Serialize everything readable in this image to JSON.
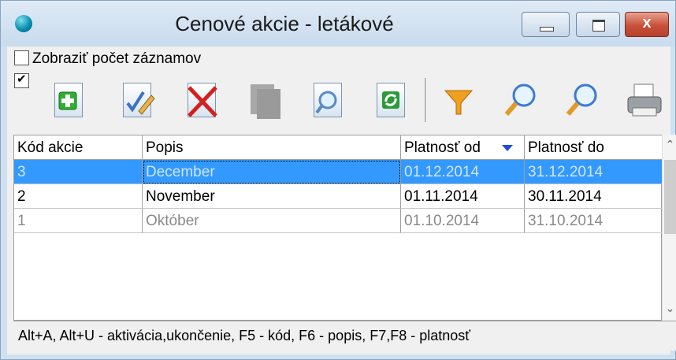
{
  "window": {
    "title": "Cenové akcie - letákové",
    "controls": {
      "minimize": "minimize",
      "maximize": "maximize",
      "close": "x"
    }
  },
  "options": {
    "show_count_label": "Zobraziť počet záznamov",
    "show_count_checked": false,
    "select_all_checked": true
  },
  "toolbar": {
    "icons": [
      "add-icon",
      "edit-icon",
      "delete-icon",
      "copy-icon",
      "view-icon",
      "refresh-icon",
      "filter-icon",
      "search-icon",
      "find-next-icon",
      "print-icon"
    ]
  },
  "table": {
    "columns": [
      "Kód akcie",
      "Popis",
      "Platnosť od",
      "Platnosť do"
    ],
    "sorted_column": "Platnosť od",
    "sort_direction": "descending",
    "rows": [
      {
        "kod": "3",
        "popis": "December",
        "od": "01.12.2014",
        "do": "31.12.2014",
        "state": "selected"
      },
      {
        "kod": "2",
        "popis": "November",
        "od": "01.11.2014",
        "do": "30.11.2014",
        "state": "active"
      },
      {
        "kod": "1",
        "popis": "Október",
        "od": "01.10.2014",
        "do": "31.10.2014",
        "state": "inactive"
      }
    ]
  },
  "status": {
    "hint": "Alt+A, Alt+U - aktivácia,ukončenie, F5 - kód, F6 - popis, F7,F8 - platnosť"
  },
  "colors": {
    "selection": "#3399ff",
    "close_button": "#c8503a",
    "sort_arrow": "#1f4fd1"
  }
}
